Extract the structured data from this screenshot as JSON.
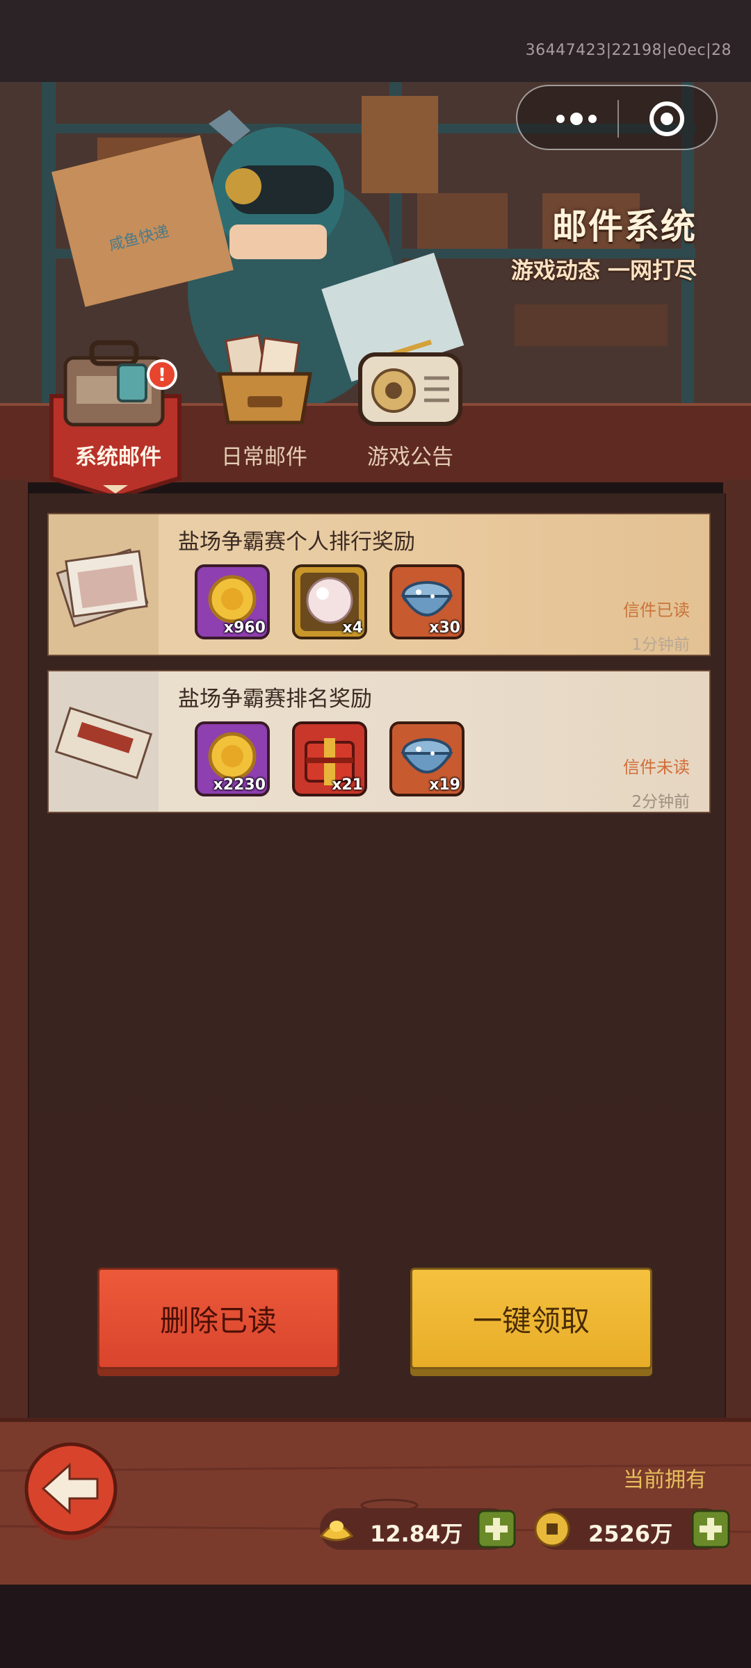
{
  "system": {
    "build_id": "36447423|22198|e0ec|28"
  },
  "hero": {
    "title": "邮件系统",
    "subtitle": "游戏动态 一网打尽"
  },
  "tabs": [
    {
      "label": "系统邮件",
      "active": true,
      "badge": "!"
    },
    {
      "label": "日常邮件",
      "active": false
    },
    {
      "label": "游戏公告",
      "active": false
    }
  ],
  "mails": [
    {
      "subject": "盐场争霸赛个人排行奖励",
      "status": "信件已读",
      "time": "1分钟前",
      "items": [
        {
          "icon": "gold-coin-icon",
          "qty": "x960"
        },
        {
          "icon": "pearl-icon",
          "qty": "x4"
        },
        {
          "icon": "blue-bowl-icon",
          "qty": "x30"
        }
      ]
    },
    {
      "subject": "盐场争霸赛排名奖励",
      "status": "信件未读",
      "time": "2分钟前",
      "items": [
        {
          "icon": "gold-coin-icon",
          "qty": "x2230"
        },
        {
          "icon": "red-chest-icon",
          "qty": "x21"
        },
        {
          "icon": "blue-bowl-icon",
          "qty": "x19"
        }
      ]
    }
  ],
  "buttons": {
    "delete_read": "删除已读",
    "claim_all": "一键领取"
  },
  "footer": {
    "owned_label": "当前拥有",
    "resources": [
      {
        "icon": "gold-ingot-icon",
        "value": "12.84万"
      },
      {
        "icon": "copper-coin-icon",
        "value": "2526万"
      }
    ]
  },
  "colors": {
    "accent_red": "#d9452d",
    "accent_gold": "#e8ad28",
    "panel": "#3b2420"
  }
}
